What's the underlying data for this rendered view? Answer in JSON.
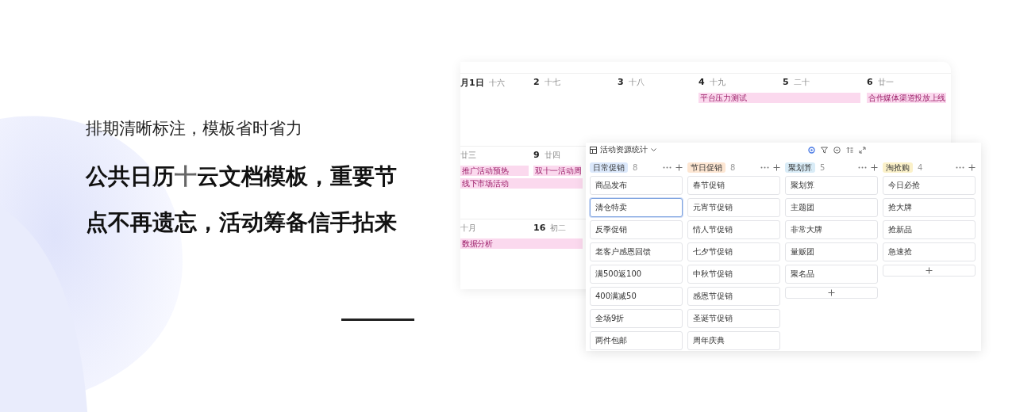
{
  "intro": {
    "subtitle": "排期清晰标注，模板省时省力",
    "headline_before": "公共日历",
    "headline_plus": "十",
    "headline_after": "云文档模板，重要节点不再遗忘，活动筹备信手拈来"
  },
  "calendar": {
    "weeks": [
      {
        "days": [
          {
            "date": "月1日",
            "lunar": "十六"
          },
          {
            "date": "2",
            "lunar": "十七"
          },
          {
            "date": "3",
            "lunar": "十八"
          },
          {
            "date": "4",
            "lunar": "十九",
            "events": [
              {
                "title": "平台压力测试",
                "wide": true
              }
            ]
          },
          {
            "date": "5",
            "lunar": "二十"
          },
          {
            "date": "6",
            "lunar": "廿一",
            "events": [
              {
                "title": "合作媒体渠道投放上线",
                "wide": false
              }
            ]
          }
        ]
      },
      {
        "days": [
          {
            "lunar": "廿三",
            "events": [
              {
                "title": "推广活动预热",
                "wide": false
              },
              {
                "title": "线下市场活动",
                "wide": true
              }
            ]
          },
          {
            "date": "9",
            "lunar": "廿四",
            "events": [
              {
                "title": "双十一活动周",
                "wide": false
              }
            ]
          }
        ]
      },
      {
        "days": [
          {
            "lunar": "十月",
            "events": [
              {
                "title": "数据分析",
                "wide": true
              }
            ]
          },
          {
            "date": "16",
            "lunar": "初二"
          }
        ]
      }
    ]
  },
  "board": {
    "title": "活动资源统计",
    "columns": [
      {
        "label": "日常促销",
        "count": "8",
        "color": "#dbe8fb",
        "cards": [
          {
            "text": "商品发布",
            "selected": false
          },
          {
            "text": "清仓特卖",
            "selected": true
          },
          {
            "text": "反季促销",
            "selected": false
          },
          {
            "text": "老客户感恩回馈",
            "selected": false
          },
          {
            "text": "满500返100",
            "selected": false
          },
          {
            "text": "400满减50",
            "selected": false
          },
          {
            "text": "全场9折",
            "selected": false
          },
          {
            "text": "两件包邮",
            "selected": false
          }
        ]
      },
      {
        "label": "节日促销",
        "count": "8",
        "color": "#fde6d2",
        "cards": [
          {
            "text": "春节促销",
            "selected": false
          },
          {
            "text": "元宵节促销",
            "selected": false
          },
          {
            "text": "情人节促销",
            "selected": false
          },
          {
            "text": "七夕节促销",
            "selected": false
          },
          {
            "text": "中秋节促销",
            "selected": false
          },
          {
            "text": "感恩节促销",
            "selected": false
          },
          {
            "text": "圣诞节促销",
            "selected": false
          },
          {
            "text": "周年庆典",
            "selected": false
          }
        ]
      },
      {
        "label": "聚划算",
        "count": "5",
        "color": "#d9ecf7",
        "cards": [
          {
            "text": "聚划算",
            "selected": false
          },
          {
            "text": "主题团",
            "selected": false
          },
          {
            "text": "非常大牌",
            "selected": false
          },
          {
            "text": "量贩团",
            "selected": false
          },
          {
            "text": "聚名品",
            "selected": false
          }
        ]
      },
      {
        "label": "淘抢购",
        "count": "4",
        "color": "#fbf1c9",
        "cards": [
          {
            "text": "今日必抢",
            "selected": false
          },
          {
            "text": "抢大牌",
            "selected": false
          },
          {
            "text": "抢新品",
            "selected": false
          },
          {
            "text": "急速抢",
            "selected": false
          }
        ]
      }
    ]
  }
}
